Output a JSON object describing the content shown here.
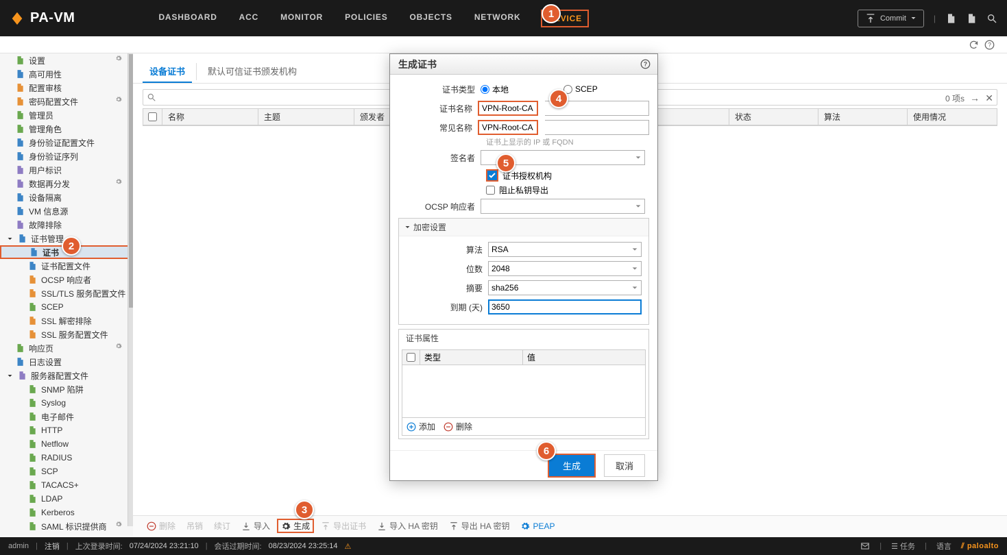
{
  "brand": "PA-VM",
  "topnav": {
    "dashboard": "DASHBOARD",
    "acc": "ACC",
    "monitor": "MONITOR",
    "policies": "POLICIES",
    "objects": "OBJECTS",
    "network": "NETWORK",
    "device": "DEVICE"
  },
  "commit": "Commit",
  "row2": {},
  "sidebar": [
    {
      "lvl": 1,
      "key": "settings",
      "label": "设置",
      "icon": "gear",
      "gear": true
    },
    {
      "lvl": 1,
      "key": "ha",
      "label": "高可用性",
      "icon": "ha"
    },
    {
      "lvl": 1,
      "key": "config-review",
      "label": "配置审核",
      "icon": "stack"
    },
    {
      "lvl": 1,
      "key": "password-profile",
      "label": "密码配置文件",
      "icon": "key",
      "gear": true
    },
    {
      "lvl": 1,
      "key": "admin",
      "label": "管理员",
      "icon": "user"
    },
    {
      "lvl": 1,
      "key": "admin-role",
      "label": "管理角色",
      "icon": "role"
    },
    {
      "lvl": 1,
      "key": "auth-profile",
      "label": "身份验证配置文件",
      "icon": "shield"
    },
    {
      "lvl": 1,
      "key": "auth-seq",
      "label": "身份验证序列",
      "icon": "seq"
    },
    {
      "lvl": 1,
      "key": "user-id",
      "label": "用户标识",
      "icon": "id"
    },
    {
      "lvl": 1,
      "key": "redist",
      "label": "数据再分发",
      "icon": "redist",
      "gear": true
    },
    {
      "lvl": 1,
      "key": "dev-iso",
      "label": "设备隔离",
      "icon": "iso"
    },
    {
      "lvl": 1,
      "key": "vm-info",
      "label": "VM 信息源",
      "icon": "vm"
    },
    {
      "lvl": 1,
      "key": "troubleshoot",
      "label": "故障排除",
      "icon": "wrench"
    },
    {
      "lvl": 1,
      "key": "cert-mgmt",
      "label": "证书管理",
      "icon": "cert",
      "caret": "down"
    },
    {
      "lvl": 2,
      "key": "cert",
      "label": "证书",
      "icon": "cert-doc",
      "selected": true,
      "boxed": true
    },
    {
      "lvl": 2,
      "key": "cert-profile",
      "label": "证书配置文件",
      "icon": "cert-doc"
    },
    {
      "lvl": 2,
      "key": "ocsp",
      "label": "OCSP 响应者",
      "icon": "ocsp"
    },
    {
      "lvl": 2,
      "key": "ssl-tls",
      "label": "SSL/TLS 服务配置文件",
      "icon": "lock"
    },
    {
      "lvl": 2,
      "key": "scep",
      "label": "SCEP",
      "icon": "scep"
    },
    {
      "lvl": 2,
      "key": "ssl-dec",
      "label": "SSL 解密排除",
      "icon": "lock"
    },
    {
      "lvl": 2,
      "key": "ssl-srv",
      "label": "SSL 服务配置文件",
      "icon": "lock"
    },
    {
      "lvl": 1,
      "key": "resp-page",
      "label": "响应页",
      "icon": "page",
      "gear": true
    },
    {
      "lvl": 1,
      "key": "log-set",
      "label": "日志设置",
      "icon": "log"
    },
    {
      "lvl": 1,
      "key": "srv-profile",
      "label": "服务器配置文件",
      "icon": "srv",
      "caret": "down"
    },
    {
      "lvl": 2,
      "key": "snmp",
      "label": "SNMP 陷阱",
      "icon": "file"
    },
    {
      "lvl": 2,
      "key": "syslog",
      "label": "Syslog",
      "icon": "file"
    },
    {
      "lvl": 2,
      "key": "email",
      "label": "电子邮件",
      "icon": "file"
    },
    {
      "lvl": 2,
      "key": "http",
      "label": "HTTP",
      "icon": "file"
    },
    {
      "lvl": 2,
      "key": "netflow",
      "label": "Netflow",
      "icon": "file"
    },
    {
      "lvl": 2,
      "key": "radius",
      "label": "RADIUS",
      "icon": "file"
    },
    {
      "lvl": 2,
      "key": "scp",
      "label": "SCP",
      "icon": "file"
    },
    {
      "lvl": 2,
      "key": "tacacs",
      "label": "TACACS+",
      "icon": "file"
    },
    {
      "lvl": 2,
      "key": "ldap",
      "label": "LDAP",
      "icon": "file"
    },
    {
      "lvl": 2,
      "key": "kerberos",
      "label": "Kerberos",
      "icon": "file"
    },
    {
      "lvl": 2,
      "key": "saml",
      "label": "SAML 标识提供商",
      "icon": "file",
      "gear": true
    }
  ],
  "tabs": {
    "device_cert": "设备证书",
    "trusted_ca": "默认可信证书颁发机构"
  },
  "grid_headers": {
    "name": "名称",
    "subject": "主题",
    "issuer": "颁发者",
    "status": "状态",
    "algo": "算法",
    "usage": "使用情况"
  },
  "grid": {
    "count": "0 项s"
  },
  "actionbar": {
    "delete": "删除",
    "revoke": "吊销",
    "renew": "续订",
    "import": "导入",
    "generate": "生成",
    "export_cert": "导出证书",
    "import_ha": "导入 HA 密钥",
    "export_ha": "导出 HA 密钥",
    "peap": "PEAP"
  },
  "dialog": {
    "title": "生成证书",
    "labels": {
      "type": "证书类型",
      "name": "证书名称",
      "cn": "常见名称",
      "signer": "签名者",
      "ca": "证书授权机构",
      "block_export": "阻止私钥导出",
      "ocsp": "OCSP 响应者",
      "crypto": "加密设置",
      "algo": "算法",
      "bits": "位数",
      "digest": "摘要",
      "expiry": "到期 (天)",
      "attrs": "证书属性",
      "attr_type": "类型",
      "attr_val": "值",
      "add": "添加",
      "delete": "删除"
    },
    "radios": {
      "local": "本地",
      "scep": "SCEP"
    },
    "values": {
      "name": "VPN-Root-CA",
      "cn": "VPN-Root-CA",
      "signer": "",
      "algo": "RSA",
      "bits": "2048",
      "digest": "sha256",
      "expiry": "3650"
    },
    "helper": "证书上显示的 IP 或 FQDN",
    "buttons": {
      "generate": "生成",
      "cancel": "取消"
    }
  },
  "footer": {
    "user": "admin",
    "logout": "注销",
    "last_login_lbl": "上次登录时间:",
    "last_login": "07/24/2024 23:21:10",
    "session_lbl": "会话过期时间:",
    "session": "08/23/2024 23:25:14",
    "tasks": "任务",
    "lang": "语言",
    "brand": "paloalto"
  },
  "bubbles": {
    "1": "1",
    "2": "2",
    "3": "3",
    "4": "4",
    "5": "5",
    "6": "6"
  }
}
